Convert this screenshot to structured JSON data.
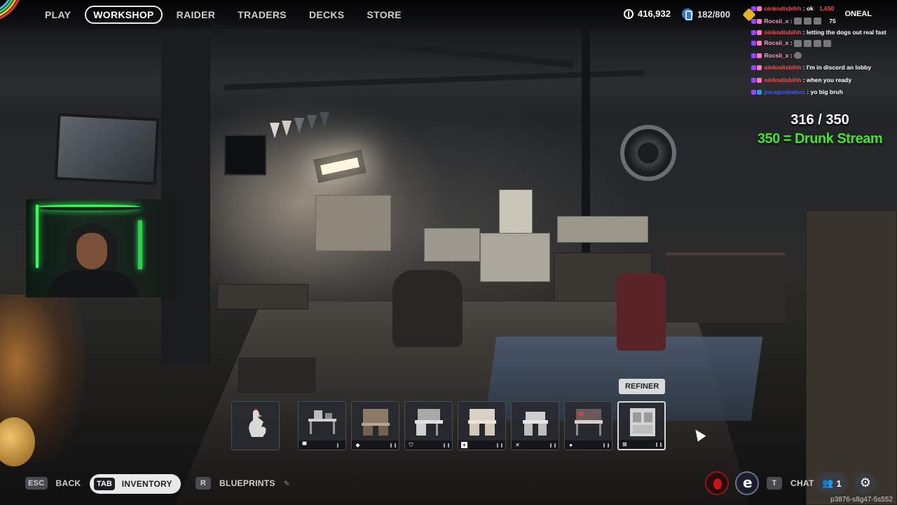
{
  "nav": {
    "items": [
      {
        "label": "PLAY",
        "active": false
      },
      {
        "label": "WORKSHOP",
        "active": true
      },
      {
        "label": "RAIDER",
        "active": false
      },
      {
        "label": "TRADERS",
        "active": false
      },
      {
        "label": "DECKS",
        "active": false
      },
      {
        "label": "STORE",
        "active": false
      }
    ]
  },
  "currency": {
    "coins": "416,932",
    "credits": "182/800",
    "gold": "1,650",
    "level": "75"
  },
  "player": {
    "name": "ONEAL"
  },
  "chat": [
    {
      "user": "oinkndisbihh",
      "message": "ok",
      "color": "red"
    },
    {
      "user": "Rocsii_x",
      "message": "",
      "emotes": 3,
      "color": "pink"
    },
    {
      "user": "oinkndisbihh",
      "message": "letting the dogs out real fast",
      "color": "red"
    },
    {
      "user": "Rocsii_x",
      "message": "",
      "emotes": 4,
      "color": "pink"
    },
    {
      "user": "Rocsii_x",
      "message": "",
      "emotes": 1,
      "color": "pink"
    },
    {
      "user": "oinkndisbihh",
      "message": "I'm in discord an lobby",
      "color": "red"
    },
    {
      "user": "oinkndisbihh",
      "message": "when you ready",
      "color": "red"
    },
    {
      "user": "paragonbabus",
      "message": "yo big bruh",
      "color": "blue"
    }
  ],
  "goal": {
    "count": "316 / 350",
    "text": "350 = Drunk Stream"
  },
  "workstations": {
    "tooltip": "REFINER",
    "slots": [
      {
        "name": "rooster",
        "icon": ""
      },
      {
        "name": "workbench",
        "icon": "workbench-icon"
      },
      {
        "name": "gunsmith",
        "icon": "gun-icon"
      },
      {
        "name": "gear-bench",
        "icon": "shield-icon"
      },
      {
        "name": "medical-lab",
        "icon": "plus-icon"
      },
      {
        "name": "explosives-station",
        "icon": "cross-icon"
      },
      {
        "name": "utility-station",
        "icon": "gear-icon"
      },
      {
        "name": "refiner",
        "icon": "refiner-icon",
        "selected": true
      }
    ]
  },
  "bottom": {
    "back_key": "ESC",
    "back_label": "BACK",
    "inventory_key": "TAB",
    "inventory_label": "INVENTORY",
    "blueprints_key": "R",
    "blueprints_label": "BLUEPRINTS",
    "chat_key": "T",
    "chat_label": "CHAT",
    "friends_count": "1",
    "session_id": "p3876-s8g47-5s552"
  },
  "colors": {
    "goal_green": "#4fdc3a",
    "chat_red": "#ff4a4a",
    "chat_pink": "#ff9fc4",
    "chat_blue": "#3b5bff"
  }
}
